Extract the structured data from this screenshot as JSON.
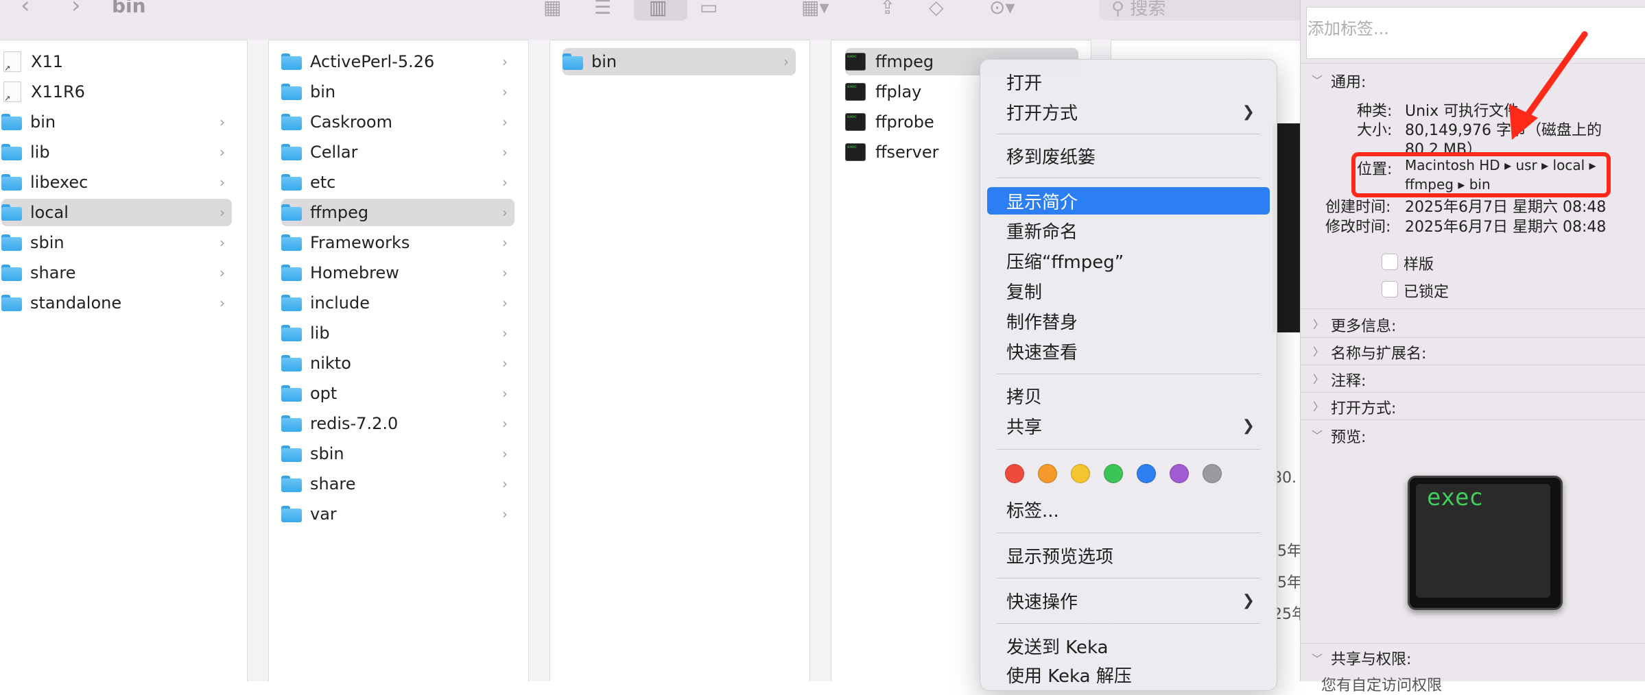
{
  "toolbar": {
    "title": "bin",
    "search_placeholder": "搜索"
  },
  "col1": [
    {
      "name": "X11",
      "type": "doc"
    },
    {
      "name": "X11R6",
      "type": "doc"
    },
    {
      "name": "bin",
      "type": "folder"
    },
    {
      "name": "lib",
      "type": "folder"
    },
    {
      "name": "libexec",
      "type": "folder"
    },
    {
      "name": "local",
      "type": "folder",
      "selected": true
    },
    {
      "name": "sbin",
      "type": "folder"
    },
    {
      "name": "share",
      "type": "folder"
    },
    {
      "name": "standalone",
      "type": "folder"
    }
  ],
  "col2": [
    {
      "name": "ActivePerl-5.26"
    },
    {
      "name": "bin"
    },
    {
      "name": "Caskroom"
    },
    {
      "name": "Cellar"
    },
    {
      "name": "etc"
    },
    {
      "name": "ffmpeg",
      "selected": true
    },
    {
      "name": "Frameworks"
    },
    {
      "name": "Homebrew"
    },
    {
      "name": "include"
    },
    {
      "name": "lib"
    },
    {
      "name": "nikto"
    },
    {
      "name": "opt"
    },
    {
      "name": "redis-7.2.0"
    },
    {
      "name": "sbin"
    },
    {
      "name": "share"
    },
    {
      "name": "var"
    }
  ],
  "col3": [
    {
      "name": "bin",
      "selected": true
    }
  ],
  "col4": [
    {
      "name": "ffmpeg",
      "selected": true
    },
    {
      "name": "ffplay"
    },
    {
      "name": "ffprobe"
    },
    {
      "name": "ffserver"
    }
  ],
  "menu": {
    "open": "打开",
    "open_with": "打开方式",
    "trash": "移到废纸篓",
    "get_info": "显示简介",
    "rename": "重新命名",
    "compress": "压缩“ffmpeg”",
    "duplicate": "复制",
    "make_alias": "制作替身",
    "quick_look": "快速查看",
    "copy": "拷贝",
    "share": "共享",
    "tags": "标签...",
    "show_preview_options": "显示预览选项",
    "quick_actions": "快速操作",
    "send_keka": "发送到 Keka",
    "extract_keka": "使用 Keka 解压",
    "tag_colors": [
      "#ee4b3e",
      "#f39a2b",
      "#f5c52f",
      "#3cc456",
      "#2e7ff0",
      "#a05bd3",
      "#9c9a9f"
    ]
  },
  "behind_window": {
    "fragments": [
      "80.",
      "5年",
      "5年",
      "25年"
    ]
  },
  "info": {
    "tag_placeholder": "添加标签...",
    "general": "通用:",
    "kind_label": "种类:",
    "kind_value": "Unix 可执行文件",
    "size_label": "大小:",
    "size_value_1": "80,149,976 字节（磁盘上的",
    "size_value_2": "80.2 MB）",
    "where_label": "位置:",
    "where_value_1": "Macintosh HD ▸ usr ▸ local ▸",
    "where_value_2": "ffmpeg ▸ bin",
    "created_label": "创建时间:",
    "created_value": "2025年6月7日 星期六 08:48",
    "modified_label": "修改时间:",
    "modified_value": "2025年6月7日 星期六 08:48",
    "stationery": "样版",
    "locked": "已锁定",
    "more_info": "更多信息:",
    "name_ext": "名称与扩展名:",
    "comments": "注释:",
    "open_with": "打开方式:",
    "preview": "预览:",
    "preview_text": "exec",
    "sharing": "共享与权限:",
    "sharing_sub": "您有自定访问权限"
  }
}
